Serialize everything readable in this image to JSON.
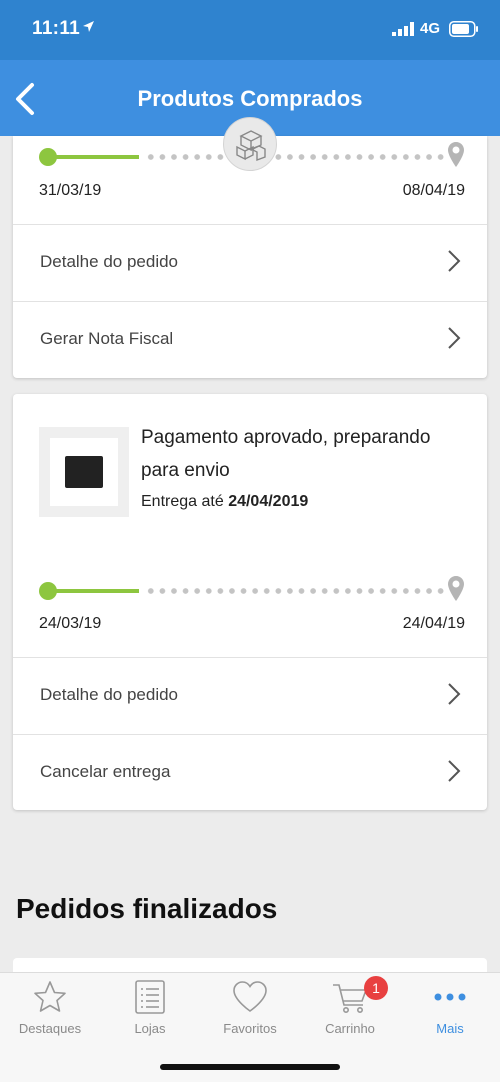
{
  "status_bar": {
    "time": "11:11",
    "network": "4G"
  },
  "header": {
    "title": "Produtos Comprados"
  },
  "order1": {
    "start_date": "31/03/19",
    "end_date": "08/04/19",
    "actions": [
      "Detalhe do pedido",
      "Gerar Nota Fiscal"
    ]
  },
  "order2": {
    "status": "Pagamento aprovado, preparando para envio",
    "delivery_prefix": "Entrega até",
    "delivery_date": "24/04/2019",
    "start_date": "24/03/19",
    "end_date": "24/04/19",
    "actions": [
      "Detalhe do pedido",
      "Cancelar entrega"
    ]
  },
  "sections": {
    "finalized_title": "Pedidos finalizados"
  },
  "tabbar": {
    "tabs": [
      {
        "label": "Destaques",
        "icon": "star-icon"
      },
      {
        "label": "Lojas",
        "icon": "list-icon"
      },
      {
        "label": "Favoritos",
        "icon": "heart-icon"
      },
      {
        "label": "Carrinho",
        "icon": "cart-icon",
        "badge": "1"
      },
      {
        "label": "Mais",
        "icon": "more-icon",
        "active": true
      }
    ]
  },
  "colors": {
    "header": "#3e8fe0",
    "status_bar": "#2f83cf",
    "progress": "#8dc63f",
    "badge": "#e84040"
  }
}
